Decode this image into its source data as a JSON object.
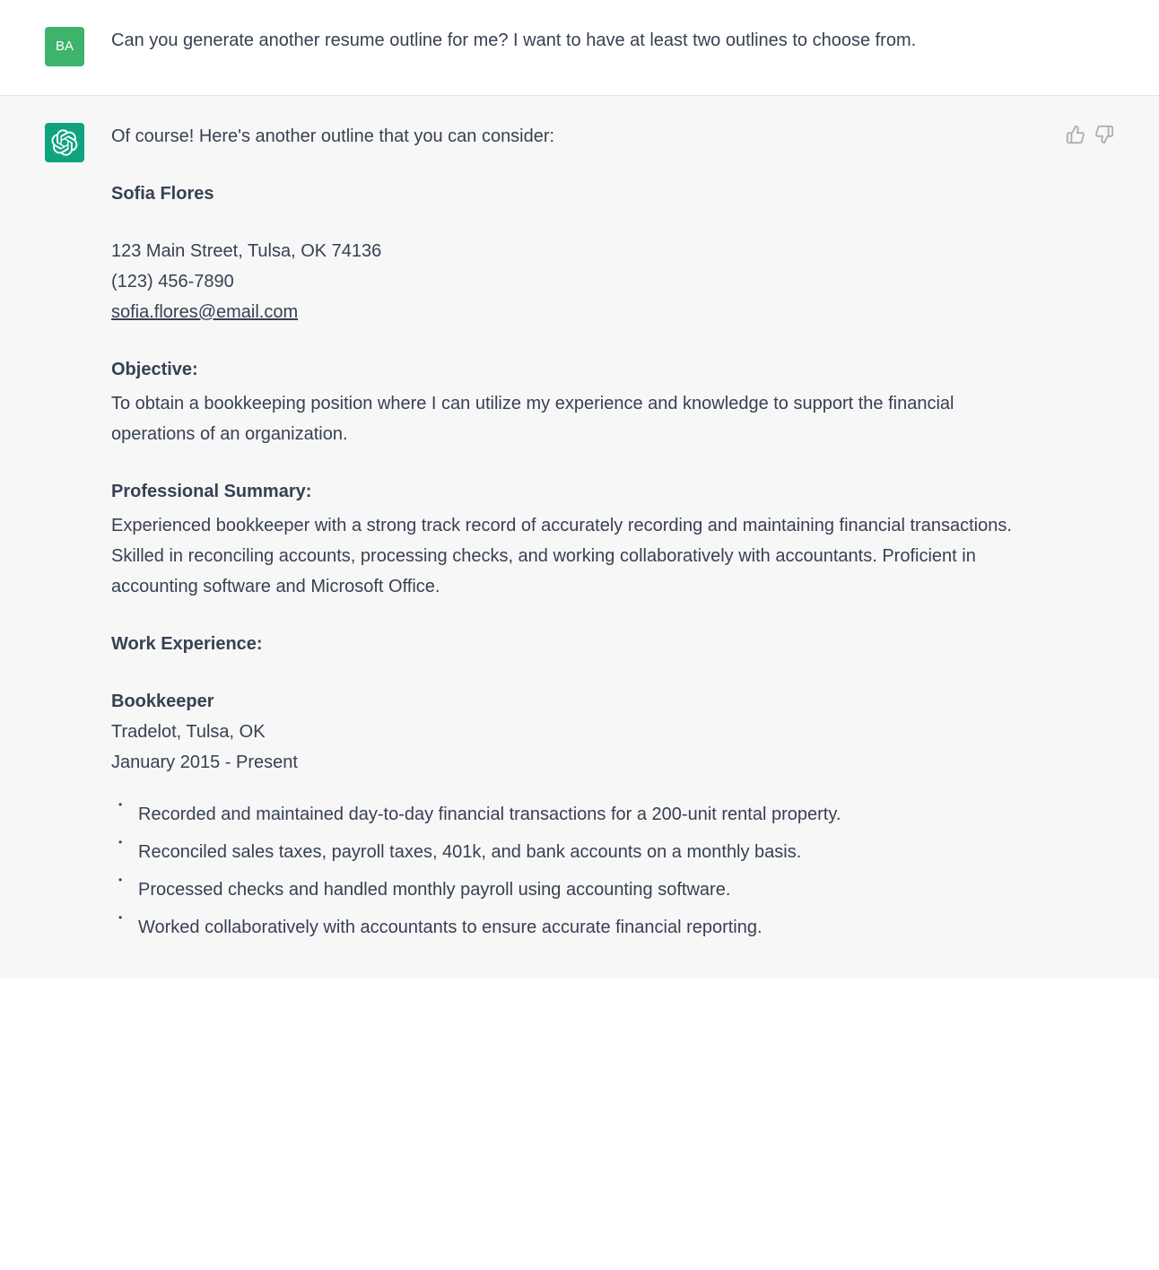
{
  "user": {
    "avatar_initials": "BA",
    "message": "Can you generate another resume outline for me? I want to have at least two outlines to choose from."
  },
  "assistant": {
    "intro": "Of course! Here's another outline that you can consider:",
    "resume": {
      "name": "Sofia Flores",
      "address": "123 Main Street, Tulsa, OK 74136",
      "phone": "(123) 456-7890",
      "email": "sofia.flores@email.com",
      "objective_label": "Objective:",
      "objective_text": "To obtain a bookkeeping position where I can utilize my experience and knowledge to support the financial operations of an organization.",
      "summary_label": "Professional Summary:",
      "summary_text": "Experienced bookkeeper with a strong track record of accurately recording and maintaining financial transactions. Skilled in reconciling accounts, processing checks, and working collaboratively with accountants. Proficient in accounting software and Microsoft Office.",
      "work_label": "Work Experience:",
      "job_title": "Bookkeeper",
      "job_company": "Tradelot, Tulsa, OK",
      "job_dates": "January 2015 - Present",
      "bullets": {
        "0": "Recorded and maintained day-to-day financial transactions for a 200-unit rental property.",
        "1": "Reconciled sales taxes, payroll taxes, 401k, and bank accounts on a monthly basis.",
        "2": "Processed checks and handled monthly payroll using accounting software.",
        "3": "Worked collaboratively with accountants to ensure accurate financial reporting."
      }
    }
  }
}
